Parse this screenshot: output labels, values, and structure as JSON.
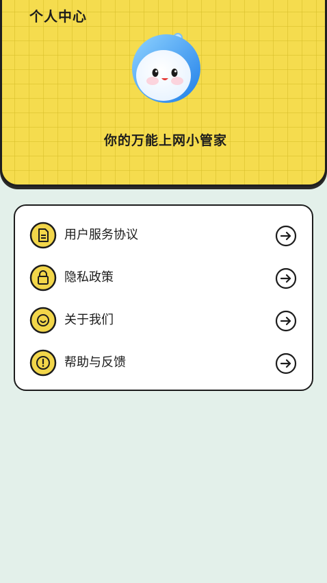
{
  "header": {
    "title": "个人中心",
    "tagline": "你的万能上网小管家",
    "avatar_icon": "robot-mascot-icon"
  },
  "menu": {
    "items": [
      {
        "label": "用户服务协议",
        "icon": "document-icon"
      },
      {
        "label": "隐私政策",
        "icon": "lock-icon"
      },
      {
        "label": "关于我们",
        "icon": "smiley-icon"
      },
      {
        "label": "帮助与反馈",
        "icon": "exclamation-icon"
      }
    ],
    "arrow_icon": "arrow-right-circle-icon"
  },
  "colors": {
    "header_yellow": "#f5dc4e",
    "page_background": "#e3f0ea",
    "icon_yellow": "#f2d64a",
    "outline": "#1c1c1c"
  }
}
